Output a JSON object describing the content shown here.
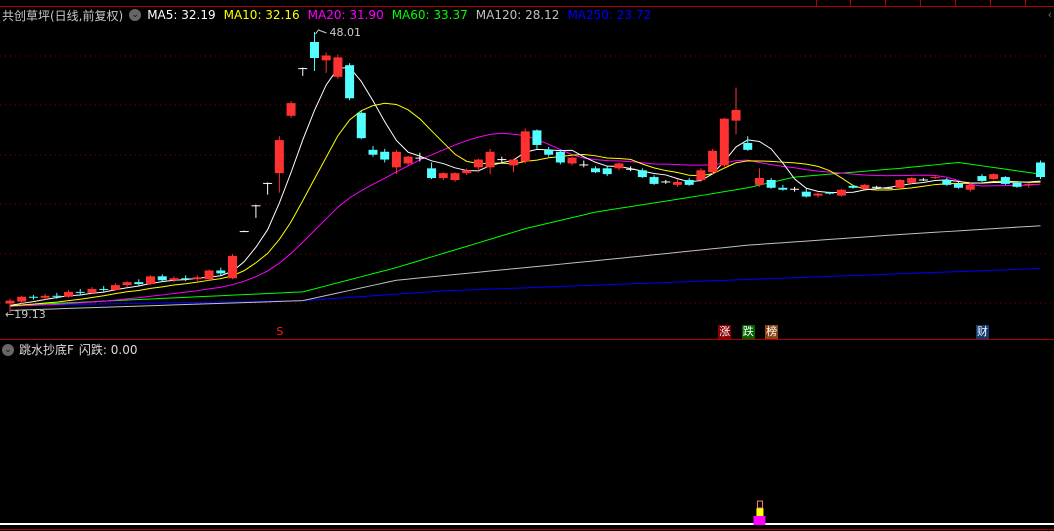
{
  "header": {
    "title": "共创草坪(日线,前复权)",
    "ma": [
      {
        "label": "MA5: 32.19",
        "color": "#ffffff"
      },
      {
        "label": "MA10: 32.16",
        "color": "#ffff00"
      },
      {
        "label": "MA20: 31.90",
        "color": "#ff00ff"
      },
      {
        "label": "MA60: 33.37",
        "color": "#00ff00"
      },
      {
        "label": "MA120: 28.12",
        "color": "#c0c0c0"
      },
      {
        "label": "MA250: 23.72",
        "color": "#0000ff"
      }
    ]
  },
  "indicator": {
    "name": "跳水抄底F",
    "value_label": "闪跌: 0.00"
  },
  "chart_data": {
    "type": "candlestick",
    "high_label": "48.01",
    "low_label": "19.13",
    "ylim": [
      18.3,
      49.2
    ],
    "colors": {
      "up": "#ff3232",
      "down": "#54ffff",
      "grid": "#8b0000"
    },
    "candles_ohlc": [
      [
        20.1,
        20.6,
        19.13,
        20.4
      ],
      [
        20.3,
        20.9,
        20.1,
        20.8
      ],
      [
        20.8,
        21.0,
        20.5,
        20.7
      ],
      [
        20.7,
        21.1,
        20.5,
        20.9
      ],
      [
        20.9,
        21.2,
        20.6,
        20.8
      ],
      [
        20.8,
        21.5,
        20.7,
        21.3
      ],
      [
        21.3,
        21.6,
        21.0,
        21.2
      ],
      [
        21.2,
        21.8,
        21.1,
        21.6
      ],
      [
        21.6,
        21.9,
        21.3,
        21.5
      ],
      [
        21.5,
        22.2,
        21.4,
        22.0
      ],
      [
        22.0,
        22.4,
        21.8,
        22.3
      ],
      [
        22.3,
        22.6,
        21.9,
        22.1
      ],
      [
        22.1,
        23.0,
        22.0,
        22.9
      ],
      [
        22.9,
        23.1,
        22.4,
        22.5
      ],
      [
        22.5,
        22.9,
        22.3,
        22.7
      ],
      [
        22.7,
        23.0,
        22.4,
        22.6
      ],
      [
        22.6,
        23.0,
        22.4,
        22.8
      ],
      [
        22.6,
        23.6,
        22.5,
        23.5
      ],
      [
        23.5,
        23.8,
        23.0,
        23.2
      ],
      [
        22.7,
        25.2,
        22.6,
        25.0
      ],
      [
        27.5,
        27.6,
        27.5,
        27.55
      ],
      [
        30.2,
        30.25,
        28.9,
        30.2
      ],
      [
        32.5,
        32.55,
        31.3,
        32.5
      ],
      [
        33.5,
        37.3,
        31.5,
        36.9
      ],
      [
        39.4,
        40.9,
        39.2,
        40.7
      ],
      [
        44.3,
        44.35,
        43.5,
        44.3
      ],
      [
        46.98,
        48.01,
        44.0,
        45.34
      ],
      [
        45.1,
        45.9,
        43.8,
        45.6
      ],
      [
        43.4,
        45.7,
        43.2,
        45.4
      ],
      [
        44.6,
        44.8,
        41.0,
        41.2
      ],
      [
        39.7,
        39.9,
        37.0,
        37.1
      ],
      [
        35.9,
        36.3,
        35.2,
        35.4
      ],
      [
        35.7,
        36.0,
        34.6,
        34.9
      ],
      [
        34.1,
        35.9,
        33.4,
        35.7
      ],
      [
        34.5,
        35.3,
        34.3,
        35.2
      ],
      [
        35.1,
        35.6,
        34.7,
        35.05
      ],
      [
        34.0,
        34.6,
        32.9,
        33.0
      ],
      [
        33.0,
        33.6,
        32.8,
        33.5
      ],
      [
        32.8,
        33.6,
        32.6,
        33.5
      ],
      [
        33.5,
        34.0,
        33.3,
        33.8
      ],
      [
        34.1,
        35.0,
        33.6,
        34.9
      ],
      [
        34.1,
        36.0,
        33.4,
        35.7
      ],
      [
        34.9,
        35.2,
        34.6,
        34.95
      ],
      [
        34.3,
        35.0,
        33.6,
        34.9
      ],
      [
        34.7,
        38.1,
        34.5,
        37.8
      ],
      [
        37.9,
        38.0,
        36.0,
        36.4
      ],
      [
        35.9,
        36.2,
        35.2,
        35.4
      ],
      [
        35.7,
        35.9,
        34.4,
        34.6
      ],
      [
        34.5,
        35.2,
        34.3,
        35.1
      ],
      [
        34.35,
        34.8,
        34.1,
        34.4
      ],
      [
        34.0,
        34.2,
        33.5,
        33.6
      ],
      [
        34.0,
        34.2,
        33.2,
        33.4
      ],
      [
        34.0,
        34.6,
        33.8,
        34.5
      ],
      [
        33.9,
        34.2,
        33.7,
        33.95
      ],
      [
        33.8,
        34.0,
        33.0,
        33.1
      ],
      [
        33.1,
        33.3,
        32.3,
        32.4
      ],
      [
        32.6,
        32.8,
        32.4,
        32.65
      ],
      [
        32.3,
        32.9,
        32.1,
        32.6
      ],
      [
        32.8,
        33.0,
        32.2,
        32.3
      ],
      [
        32.8,
        34.0,
        32.6,
        33.8
      ],
      [
        33.6,
        36.0,
        33.3,
        35.8
      ],
      [
        34.3,
        39.2,
        34.0,
        39.1
      ],
      [
        38.9,
        42.3,
        37.5,
        40.0
      ],
      [
        36.6,
        37.3,
        35.8,
        35.9
      ],
      [
        32.3,
        34.0,
        32.1,
        33.0
      ],
      [
        32.8,
        33.0,
        31.9,
        32.0
      ],
      [
        32.0,
        32.3,
        31.7,
        31.8
      ],
      [
        31.9,
        32.1,
        31.6,
        31.85
      ],
      [
        31.6,
        31.9,
        31.0,
        31.1
      ],
      [
        31.2,
        31.5,
        31.0,
        31.4
      ],
      [
        31.5,
        31.6,
        31.3,
        31.4
      ],
      [
        31.2,
        31.9,
        31.1,
        31.8
      ],
      [
        32.2,
        32.3,
        31.9,
        32.0
      ],
      [
        31.9,
        32.4,
        31.8,
        32.3
      ],
      [
        32.1,
        32.2,
        31.9,
        32.05
      ],
      [
        32.0,
        32.1,
        31.9,
        32.0
      ],
      [
        32.0,
        32.9,
        31.9,
        32.8
      ],
      [
        32.5,
        33.1,
        32.4,
        33.0
      ],
      [
        32.8,
        33.0,
        32.7,
        32.85
      ],
      [
        33.0,
        33.2,
        32.9,
        33.1
      ],
      [
        32.8,
        33.0,
        32.2,
        32.3
      ],
      [
        32.4,
        32.6,
        31.9,
        32.0
      ],
      [
        31.8,
        32.6,
        31.6,
        32.3
      ],
      [
        33.2,
        33.4,
        32.6,
        32.7
      ],
      [
        32.9,
        33.5,
        32.8,
        33.4
      ],
      [
        33.1,
        33.2,
        32.3,
        32.4
      ],
      [
        32.5,
        32.6,
        32.0,
        32.1
      ],
      [
        32.3,
        32.5,
        32.0,
        32.4
      ],
      [
        34.6,
        34.8,
        32.9,
        33.1
      ]
    ],
    "ma60_points": [
      [
        0,
        19.9
      ],
      [
        25,
        21.3
      ],
      [
        33,
        23.8
      ],
      [
        44,
        27.8
      ],
      [
        50,
        29.5
      ],
      [
        59,
        31.2
      ],
      [
        63,
        32.0
      ],
      [
        67,
        33.1
      ],
      [
        76,
        34.0
      ],
      [
        81,
        34.6
      ],
      [
        88,
        33.4
      ]
    ],
    "ma120_points": [
      [
        0,
        19.4
      ],
      [
        25,
        20.4
      ],
      [
        33,
        22.5
      ],
      [
        50,
        24.5
      ],
      [
        63,
        26.1
      ],
      [
        76,
        27.2
      ],
      [
        88,
        28.1
      ]
    ],
    "ma250_points": [
      [
        0,
        19.9
      ],
      [
        25,
        20.4
      ],
      [
        37,
        21.4
      ],
      [
        59,
        22.4
      ],
      [
        88,
        23.7
      ]
    ]
  },
  "markers": [
    {
      "text": "S",
      "index": 23,
      "bg": "#000",
      "color": "#ff2020"
    },
    {
      "text": "涨",
      "index": 61,
      "bg": "#8b0000",
      "color": "#fff"
    },
    {
      "text": "跌",
      "index": 63,
      "bg": "#006400",
      "color": "#fff"
    },
    {
      "text": "榜",
      "index": 65,
      "bg": "#8b4513",
      "color": "#fff"
    },
    {
      "text": "财",
      "index": 83,
      "bg": "#103a70",
      "color": "#fff"
    }
  ],
  "signal_index": 64
}
